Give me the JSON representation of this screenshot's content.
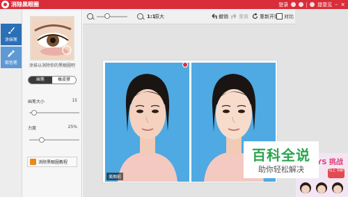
{
  "window": {
    "title": "消除黑眼圈",
    "login_label": "登录",
    "feedback_label": "提意见",
    "minimize": "–",
    "close": "×",
    "accent_color": "#d92d3a"
  },
  "tools": [
    {
      "label": "涂抹笔",
      "icon": "brush-icon",
      "active": true
    },
    {
      "label": "取色笔",
      "icon": "eyedropper-icon",
      "active": false
    }
  ],
  "panel": {
    "preview_caption": "涂抹以消除你的黑眼圈吧",
    "modes": [
      {
        "label": "画笔",
        "selected": true
      },
      {
        "label": "橡皮擦",
        "selected": false
      }
    ],
    "brush_size": {
      "label": "画笔大小",
      "value": "15",
      "level": 0.1
    },
    "strength": {
      "label": "力度",
      "value": "25%",
      "level": 0.25
    },
    "tutorial_label": "消除黑眼圈教程"
  },
  "workspace": {
    "zoom_level": 0.35,
    "ratio_label": "1:1",
    "fit_label": "原大",
    "undo_label": "撤销",
    "redo_label": "重做",
    "reset_label": "重新开始",
    "compare_label": "对比",
    "before_label": "美图前",
    "photo_background": "#4fa9e2"
  },
  "overlay": {
    "watermark_title": "百科全说",
    "watermark_subtitle": "助你轻松解决",
    "watermark_color": "#2aa54c",
    "ad_text": "YS 挑战",
    "ad_badge": "马上 领取"
  }
}
